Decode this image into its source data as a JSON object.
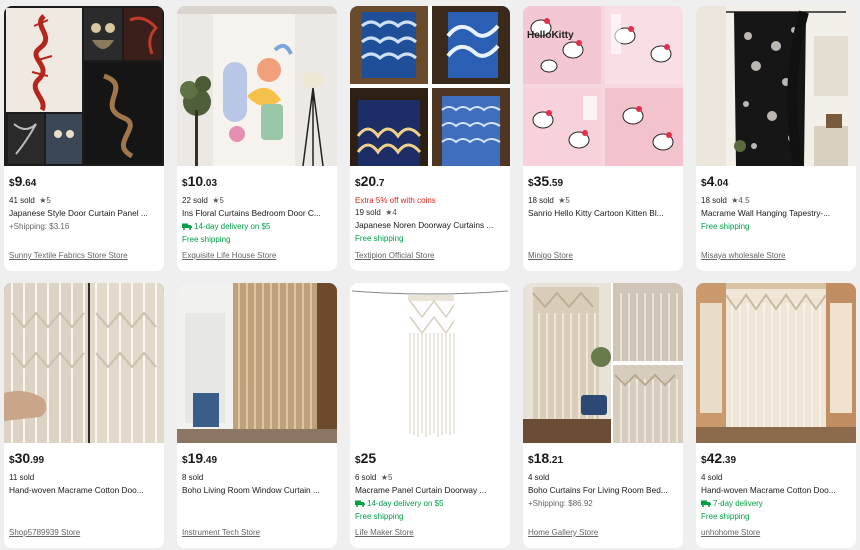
{
  "currency": "$",
  "products": [
    {
      "price_int": "9",
      "price_dec": ".64",
      "promo": "",
      "sold": "41 sold",
      "rating": "★5",
      "title": "Japanese Style Door Curtain Panel ...",
      "shipping": "+Shipping: $3.16",
      "delivery": "",
      "free_shipping": "",
      "store": "Sunny Textile Fabrics Store Store",
      "image": "dragon-owl-curtains"
    },
    {
      "price_int": "10",
      "price_dec": ".03",
      "promo": "",
      "sold": "22 sold",
      "rating": "★5",
      "title": "Ins Floral Curtains Bedroom Door C...",
      "shipping": "",
      "delivery": "14-day delivery on $5",
      "free_shipping": "Free shipping",
      "store": "Exquisite Life House Store",
      "image": "floral-curtain-room"
    },
    {
      "price_int": "20",
      "price_dec": ".7",
      "promo": "Extra 5% off with coins",
      "sold": "19 sold",
      "rating": "★4",
      "title": "Japanese Noren Doorway Curtains ...",
      "shipping": "",
      "delivery": "",
      "free_shipping": "Free shipping",
      "store": "Textipion Official Store",
      "image": "wave-noren-curtains"
    },
    {
      "price_int": "35",
      "price_dec": ".59",
      "promo": "",
      "sold": "18 sold",
      "rating": "★5",
      "title": "Sanrio Hello Kitty Cartoon Kitten Bl...",
      "shipping": "",
      "delivery": "",
      "free_shipping": "",
      "store": "Minigo Store",
      "image": "hello-kitty-curtains",
      "brand_text": "HelloKitty"
    },
    {
      "price_int": "4",
      "price_dec": ".04",
      "promo": "",
      "sold": "18 sold",
      "rating": "★4.5",
      "title": "Macrame Wall Hanging Tapestry-...",
      "shipping": "",
      "delivery": "",
      "free_shipping": "Free shipping",
      "store": "Misaya wholesale Store",
      "image": "black-lace-curtain"
    },
    {
      "price_int": "30",
      "price_dec": ".99",
      "promo": "",
      "sold": "11 sold",
      "rating": "",
      "title": "Hand-woven Macrame Cotton Doo...",
      "shipping": "",
      "delivery": "",
      "free_shipping": "",
      "store": "Shop5789939 Store",
      "image": "macrame-panels-hand"
    },
    {
      "price_int": "19",
      "price_dec": ".49",
      "promo": "",
      "sold": "8 sold",
      "rating": "",
      "title": "Boho Living Room Window Curtain ...",
      "shipping": "",
      "delivery": "",
      "free_shipping": "",
      "store": "Instrument Tech Store",
      "image": "boho-fringe-doorway"
    },
    {
      "price_int": "25",
      "price_dec": "",
      "promo": "",
      "sold": "6 sold",
      "rating": "★5",
      "title": "Macrame Panel Curtain Doorway ...",
      "shipping": "",
      "delivery": "14-day delivery on $5",
      "free_shipping": "Free shipping",
      "store": "Life Maker Store",
      "image": "macrame-single-panel"
    },
    {
      "price_int": "18",
      "price_dec": ".21",
      "promo": "",
      "sold": "4 sold",
      "rating": "",
      "title": "Boho Curtains For Living Room Bed...",
      "shipping": "+Shipping: $86.92",
      "delivery": "",
      "free_shipping": "",
      "store": "Home Gallery Store",
      "image": "boho-curtains-collage"
    },
    {
      "price_int": "42",
      "price_dec": ".39",
      "promo": "",
      "sold": "4 sold",
      "rating": "",
      "title": "Hand-woven Macrame Cotton Doo...",
      "shipping": "",
      "delivery": "7-day delivery",
      "free_shipping": "Free shipping",
      "store": "unhohome Store",
      "image": "macrame-wide-room"
    }
  ],
  "colors": {
    "promo": "#e1251b",
    "delivery": "#00a046",
    "store": "#666666"
  }
}
